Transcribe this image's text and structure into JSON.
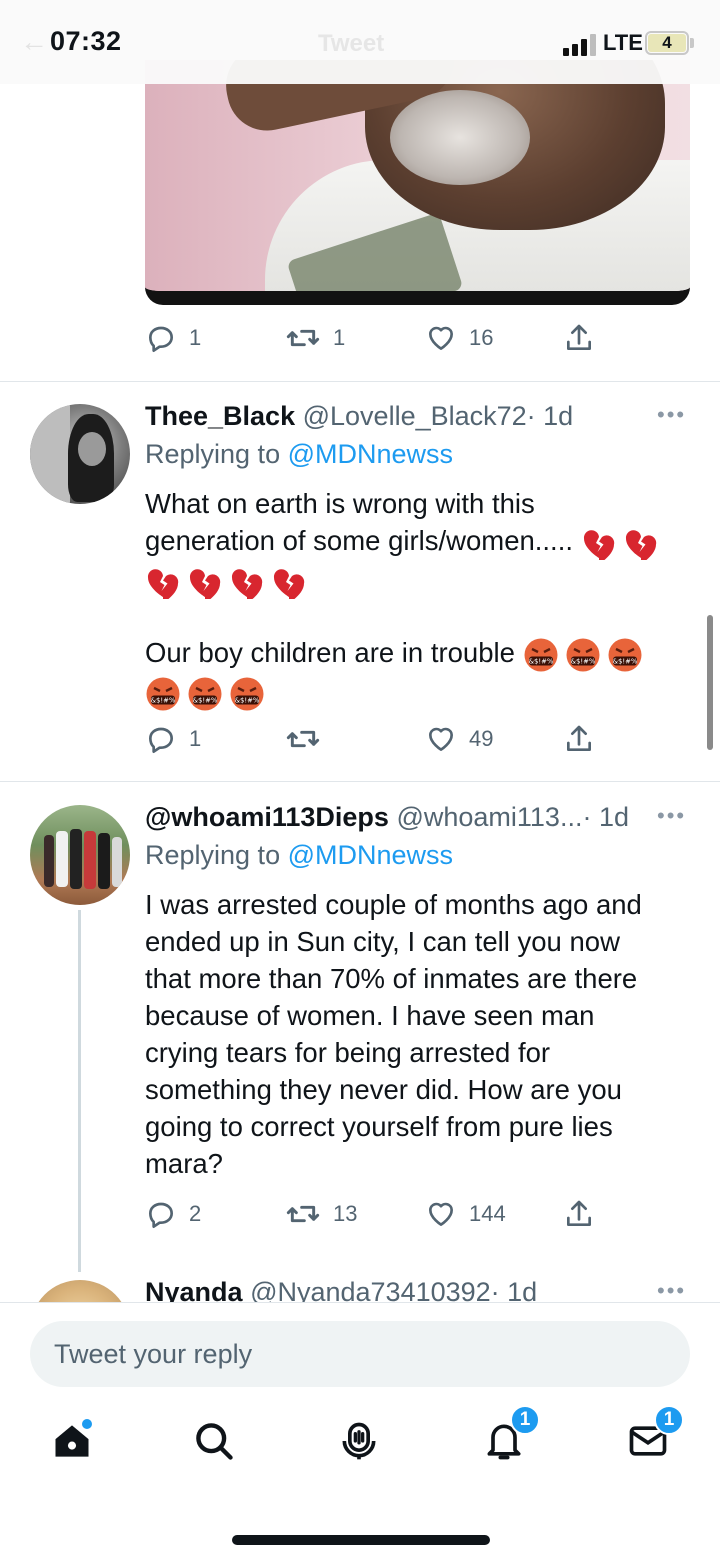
{
  "status_bar": {
    "time": "07:32",
    "ghost_title": "Tweet",
    "network": "LTE",
    "battery": "4"
  },
  "tweets": [
    {
      "actions": {
        "replies": "1",
        "retweets": "1",
        "likes": "16"
      }
    },
    {
      "display_name": "Thee_Black",
      "handle": "@Lovelle_Black72",
      "time": "· 1d",
      "replying_prefix": "Replying to ",
      "replying_to": "@MDNnewss",
      "text_line1": "What on earth is wrong with this",
      "text_line2": "generation of some girls/women.....",
      "text_para2": "Our boy children are in trouble",
      "actions": {
        "replies": "1",
        "retweets": "",
        "likes": "49"
      }
    },
    {
      "display_name": "@whoami113Dieps",
      "handle": "@whoami113...",
      "time": "· 1d",
      "replying_prefix": "Replying to ",
      "replying_to": "@MDNnewss",
      "text": "I was arrested couple of months ago and\nended up in Sun city, I can tell you now\nthat more than 70% of inmates are there\nbecause of women. I have seen man\ncrying tears for being arrested for\nsomething they never did. How are you\ngoing to correct yourself from pure lies\nmara?",
      "actions": {
        "replies": "2",
        "retweets": "13",
        "likes": "144"
      }
    },
    {
      "display_name": "Nyanda",
      "handle": "@Nyanda73410392",
      "time": "· 1d"
    }
  ],
  "composer": {
    "placeholder": "Tweet your reply"
  },
  "nav": {
    "notifications_badge": "1",
    "messages_badge": "1"
  },
  "icons": {
    "reply": "reply-icon",
    "retweet": "retweet-icon",
    "like": "heart-icon",
    "share": "share-icon",
    "more": "more-icon",
    "home": "home-icon",
    "search": "search-icon",
    "spaces": "spaces-icon",
    "notifications": "bell-icon",
    "messages": "mail-icon"
  },
  "colors": {
    "accent": "#1d9bf0",
    "text": "#0f1419",
    "muted": "#536471",
    "broken_heart": "#d8262f",
    "angry_face": "#e8643a"
  }
}
